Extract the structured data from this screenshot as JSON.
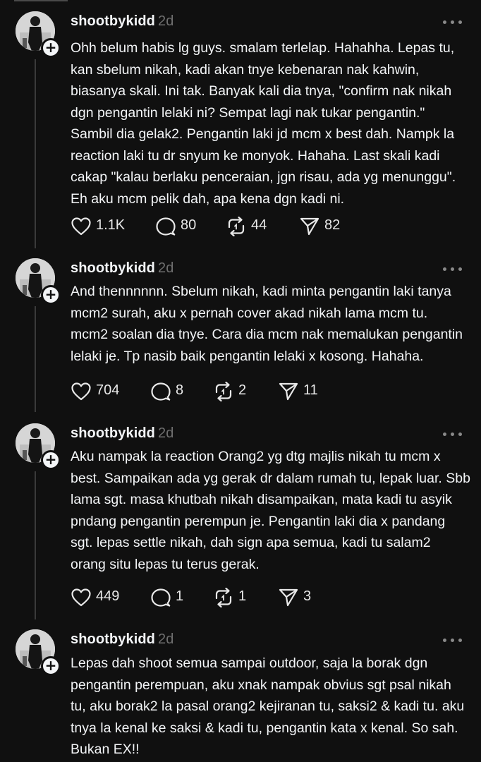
{
  "posts": [
    {
      "username": "shootbykidd",
      "time": "2d",
      "text": "Ohh belum habis lg guys. smalam terlelap. Hahahha. Lepas tu,\nkan sbelum nikah, kadi akan tnye kebenaran nak kahwin,\nbiasanya skali. Ini tak. Banyak kali dia tnya, \"confirm nak nikah\ndgn pengantin lelaki ni? Sempat lagi nak tukar pengantin.\"\nSambil dia gelak2. Pengantin laki jd mcm x best dah. Nampk la\nreaction laki tu dr snyum ke monyok. Hahaha. Last skali kadi\ncakap \"kalau berlaku penceraian, jgn risau, ada yg menunggu\".\nEh aku mcm pelik dah, apa kena dgn kadi ni.",
      "likes": "1.1K",
      "replies": "80",
      "reposts": "44",
      "shares": "82"
    },
    {
      "username": "shootbykidd",
      "time": "2d",
      "text": "And thennnnnn. Sbelum nikah, kadi minta pengantin laki tanya\nmcm2 surah, aku x pernah cover akad nikah lama mcm tu.\nmcm2 soalan dia tnye. Cara dia mcm nak memalukan pengantin\nlelaki je. Tp nasib baik pengantin lelaki x kosong. Hahaha.",
      "likes": "704",
      "replies": "8",
      "reposts": "2",
      "shares": "11"
    },
    {
      "username": "shootbykidd",
      "time": "2d",
      "text": "Aku nampak la reaction Orang2 yg dtg majlis nikah tu mcm x\nbest. Sampaikan ada yg gerak dr dalam rumah tu, lepak luar. Sbb\nlama sgt. masa khutbah nikah disampaikan, mata kadi tu asyik\npndang pengantin perempun je. Pengantin laki dia x pandang\nsgt. lepas settle nikah, dah sign apa semua, kadi tu salam2\norang situ lepas tu terus gerak.",
      "likes": "449",
      "replies": "1",
      "reposts": "1",
      "shares": "3"
    },
    {
      "username": "shootbykidd",
      "time": "2d",
      "text": "Lepas dah shoot semua sampai outdoor, saja la borak dgn\npengantin perempuan, aku xnak nampak obvius sgt psal nikah\ntu, aku borak2 la pasal orang2 kejiranan tu, saksi2 & kadi tu. aku\ntnya la kenal ke saksi & kadi tu, pengantin kata x kenal. So sah.\nBukan EX!!"
    }
  ],
  "icons": {
    "like": "heart-icon",
    "reply": "comment-icon",
    "repost": "repost-icon",
    "share": "send-icon",
    "more": "more-options-icon",
    "follow": "plus-icon"
  },
  "colors": {
    "background": "#101010",
    "text": "#f3f5f7",
    "muted": "#6f6f6f",
    "divider": "#3a3a3a"
  }
}
